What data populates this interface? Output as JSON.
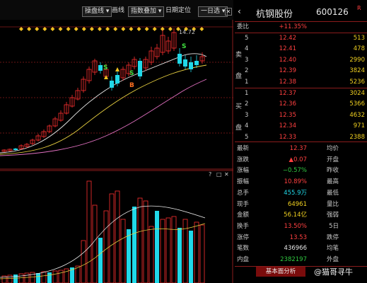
{
  "toolbar": {
    "period_select": "操盘线",
    "draw": "画线",
    "indicator_overlay": "指数叠加",
    "date_locate": "日期定位",
    "period": "一日选"
  },
  "chart": {
    "high_label": "14.72",
    "markers": [
      "S",
      "S",
      "S",
      "B"
    ]
  },
  "stock": {
    "name": "杭钢股份",
    "code": "600126",
    "badge": "R"
  },
  "order_ratio": {
    "label": "委比",
    "value": "+11.35%"
  },
  "asks": [
    {
      "n": "5",
      "price": "12.42",
      "vol": "513"
    },
    {
      "n": "4",
      "price": "12.41",
      "vol": "478"
    },
    {
      "n": "3",
      "price": "12.40",
      "vol": "2990"
    },
    {
      "n": "2",
      "price": "12.39",
      "vol": "3824"
    },
    {
      "n": "1",
      "price": "12.38",
      "vol": "5236"
    }
  ],
  "bids": [
    {
      "n": "1",
      "price": "12.37",
      "vol": "3024"
    },
    {
      "n": "2",
      "price": "12.36",
      "vol": "5366"
    },
    {
      "n": "3",
      "price": "12.35",
      "vol": "4632"
    },
    {
      "n": "4",
      "price": "12.34",
      "vol": "971"
    },
    {
      "n": "5",
      "price": "12.33",
      "vol": "2388"
    }
  ],
  "ask_side": [
    "卖",
    "盘"
  ],
  "bid_side": [
    "买",
    "盘"
  ],
  "quote": [
    {
      "l1": "最新",
      "v1": "12.37",
      "l2": "均价",
      "v2": ""
    },
    {
      "l1": "涨跌",
      "v1": "▲0.07",
      "l2": "开盘",
      "v2": ""
    },
    {
      "l1": "涨幅",
      "v1": "−0.57%",
      "l2": "昨收",
      "v2": ""
    },
    {
      "l1": "振幅",
      "v1": "10.89%",
      "l2": "最高",
      "v2": ""
    },
    {
      "l1": "总手",
      "v1": "455.9万",
      "l2": "最低",
      "v2": ""
    },
    {
      "l1": "现手",
      "v1": "64961",
      "l2": "量比",
      "v2": ""
    },
    {
      "l1": "金额",
      "v1": "56.14亿",
      "l2": "强弱",
      "v2": ""
    },
    {
      "l1": "换手",
      "v1": "13.50%",
      "l2": "5日",
      "v2": ""
    },
    {
      "l1": "涨停",
      "v1": "13.53",
      "l2": "跌停",
      "v2": ""
    },
    {
      "l1": "笔数",
      "v1": "436966",
      "l2": "均笔",
      "v2": ""
    },
    {
      "l1": "内盘",
      "v1": "2382197",
      "l2": "外盘",
      "v2": ""
    }
  ],
  "bottom": {
    "analysis_button": "基本面分析",
    "watermark": "@猫哥寻牛"
  },
  "colors": {
    "up": "#ff3030",
    "down": "#20d8e8",
    "grid": "#8a1c1c",
    "marker": "#f0c020"
  }
}
